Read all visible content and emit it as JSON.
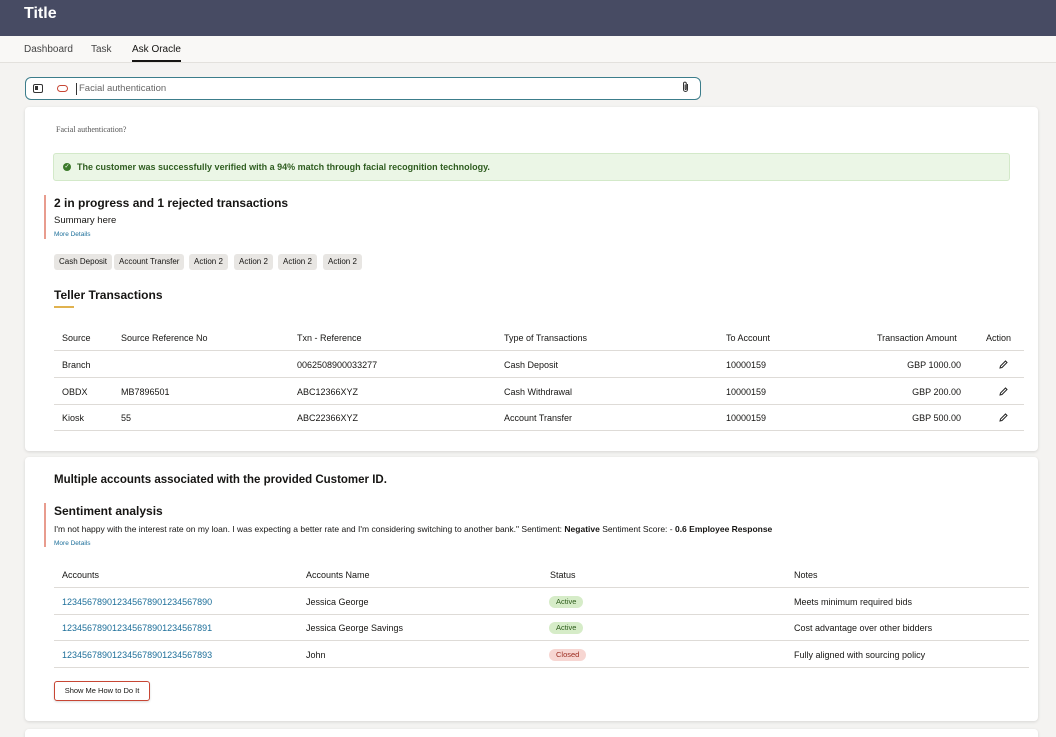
{
  "app": {
    "title": "Title"
  },
  "tabs": [
    "Dashboard",
    "Task",
    "Ask Oracle"
  ],
  "search": {
    "value": "Facial authentication"
  },
  "card1": {
    "question": "Facial authentication?",
    "success_message": "The customer was successfully verified with a 94% match through facial recognition technology.",
    "summary_heading": "2 in progress and 1 rejected transactions",
    "summary_text": "Summary here",
    "more_details": "More Details",
    "actions": [
      "Cash Deposit",
      "Account Transfer",
      "Action 2",
      "Action 2",
      "Action 2",
      "Action 2"
    ],
    "teller_title": "Teller Transactions",
    "columns": [
      "Source",
      "Source Reference No",
      "Txn - Reference",
      "Type of Transactions",
      "To Account",
      "Transaction Amount",
      "Action"
    ],
    "rows": [
      [
        "Branch",
        "",
        "0062508900033277",
        "Cash Deposit",
        "10000159",
        "GBP 1000.00"
      ],
      [
        "OBDX",
        "MB7896501",
        "ABC12366XYZ",
        "Cash Withdrawal",
        "10000159",
        "GBP 200.00"
      ],
      [
        "Kiosk",
        "55",
        "ABC22366XYZ",
        "Account Transfer",
        "10000159",
        "GBP 500.00"
      ]
    ]
  },
  "card2": {
    "heading": "Multiple accounts associated with the provided Customer ID.",
    "sentiment_heading": "Sentiment analysis",
    "sentiment_quote": "I'm not happy with the interest rate on my loan. I was expecting a better rate and I'm considering switching to another bank.\" Sentiment: ",
    "sentiment_value": "Negative",
    "sentiment_score_label": " Sentiment Score: - ",
    "sentiment_score_tail": "0.6 Employee Response",
    "more_details": "More Details",
    "columns": [
      "Accounts",
      "Accounts Name",
      "Status",
      "Notes"
    ],
    "rows": [
      [
        "1234567890123456789012345678​90",
        "Jessica George",
        "Active",
        "Meets minimum required bids"
      ],
      [
        "12345678901234567890123456789​1",
        "Jessica George Savings",
        "Active",
        "Cost advantage over other bidders"
      ],
      [
        "12345678901234567890123456789​3",
        "John",
        "Closed",
        "Fully aligned with sourcing policy"
      ]
    ],
    "button": "Show Me How to Do It"
  },
  "colors": {
    "header": "#474b63",
    "accent": "#c74634",
    "link": "#1d6f9a",
    "success": "#ebf6e6"
  }
}
